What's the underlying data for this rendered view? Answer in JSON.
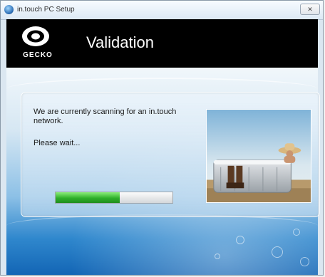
{
  "window": {
    "title": "in.touch PC Setup",
    "close_label": "✕"
  },
  "header": {
    "logo_text": "GECKO",
    "title": "Validation"
  },
  "content": {
    "message": "We are currently scanning for an in.touch network.",
    "wait": "Please wait..."
  },
  "progress": {
    "fraction": 0.55
  },
  "colors": {
    "header_bg": "#000000",
    "progress_green": "#2eb02a",
    "water_blue": "#1264b4"
  },
  "icons": {
    "app": "app-globe-icon",
    "logo": "gecko-logo-icon",
    "close": "close-icon"
  }
}
